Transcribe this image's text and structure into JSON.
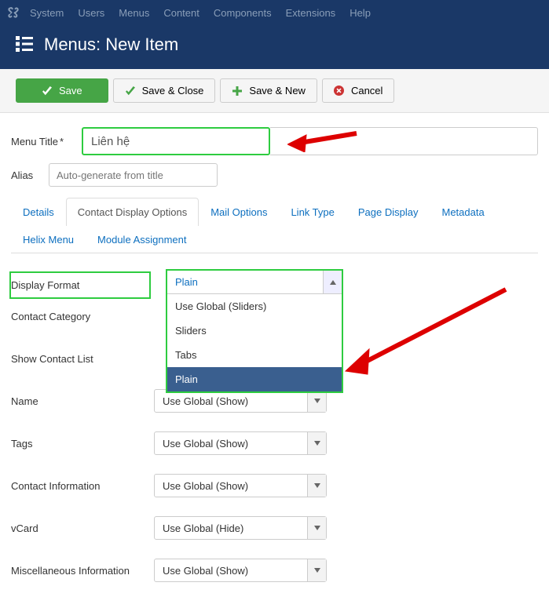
{
  "topnav": [
    "System",
    "Users",
    "Menus",
    "Content",
    "Components",
    "Extensions",
    "Help"
  ],
  "header": {
    "title": "Menus: New Item"
  },
  "toolbar": {
    "save": "Save",
    "save_close": "Save & Close",
    "save_new": "Save & New",
    "cancel": "Cancel"
  },
  "fields": {
    "menu_title_label": "Menu Title",
    "menu_title_value": "Liên hệ",
    "alias_label": "Alias",
    "alias_placeholder": "Auto-generate from title"
  },
  "tabs": [
    "Details",
    "Contact Display Options",
    "Mail Options",
    "Link Type",
    "Page Display",
    "Metadata",
    "Helix Menu",
    "Module Assignment"
  ],
  "active_tab": 1,
  "options": {
    "display_format": {
      "label": "Display Format",
      "value": "Plain",
      "items": [
        "Use Global (Sliders)",
        "Sliders",
        "Tabs",
        "Plain"
      ],
      "selected_index": 3
    },
    "contact_category": {
      "label": "Contact Category"
    },
    "show_contact_list": {
      "label": "Show Contact List"
    },
    "name": {
      "label": "Name",
      "value": "Use Global (Show)"
    },
    "tags": {
      "label": "Tags",
      "value": "Use Global (Show)"
    },
    "contact_info": {
      "label": "Contact Information",
      "value": "Use Global (Show)"
    },
    "vcard": {
      "label": "vCard",
      "value": "Use Global (Hide)"
    },
    "misc": {
      "label": "Miscellaneous Information",
      "value": "Use Global (Show)"
    }
  }
}
